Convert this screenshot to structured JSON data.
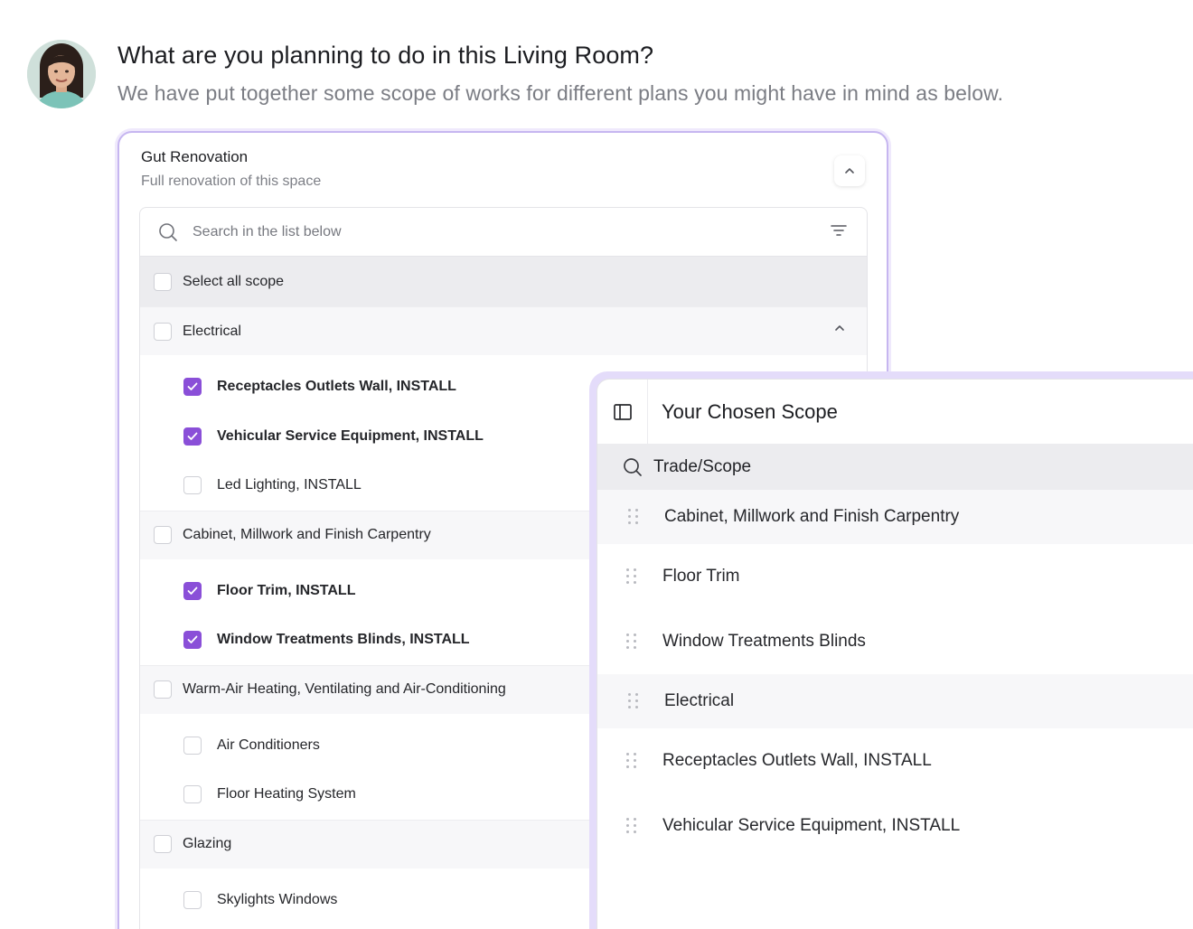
{
  "header": {
    "title": "What are you planning to do in this Living Room?",
    "subtitle": "We have put together some scope of works for different plans you might have in mind as below."
  },
  "plan_card": {
    "title": "Gut Renovation",
    "subtitle": "Full renovation of this space",
    "search_placeholder": "Search in the list below",
    "select_all_label": "Select all scope",
    "groups": [
      {
        "label": "Electrical",
        "items": [
          {
            "label": "Receptacles Outlets Wall, INSTALL",
            "checked": true
          },
          {
            "label": "Vehicular Service Equipment, INSTALL",
            "checked": true
          },
          {
            "label": "Led Lighting, INSTALL",
            "checked": false
          }
        ]
      },
      {
        "label": "Cabinet, Millwork and Finish Carpentry",
        "items": [
          {
            "label": "Floor Trim, INSTALL",
            "checked": true
          },
          {
            "label": "Window Treatments Blinds, INSTALL",
            "checked": true
          }
        ]
      },
      {
        "label": "Warm-Air Heating, Ventilating and Air-Conditioning",
        "items": [
          {
            "label": "Air Conditioners",
            "checked": false
          },
          {
            "label": "Floor Heating System",
            "checked": false
          }
        ]
      },
      {
        "label": "Glazing",
        "items": [
          {
            "label": "Skylights Windows",
            "checked": false
          }
        ]
      }
    ]
  },
  "chosen_panel": {
    "title": "Your Chosen Scope",
    "column_header": "Trade/Scope",
    "rows": [
      {
        "label": "Cabinet, Millwork and Finish Carpentry",
        "type": "group"
      },
      {
        "label": "Floor Trim",
        "type": "item"
      },
      {
        "label": "Window Treatments Blinds",
        "type": "item"
      },
      {
        "label": "Electrical",
        "type": "group"
      },
      {
        "label": "Receptacles Outlets Wall, INSTALL",
        "type": "item"
      },
      {
        "label": "Vehicular Service Equipment, INSTALL",
        "type": "item"
      }
    ]
  },
  "colors": {
    "accent": "#8a4fd8",
    "card_border": "#c6b6f0",
    "panel_frame": "#e4dcfa"
  }
}
